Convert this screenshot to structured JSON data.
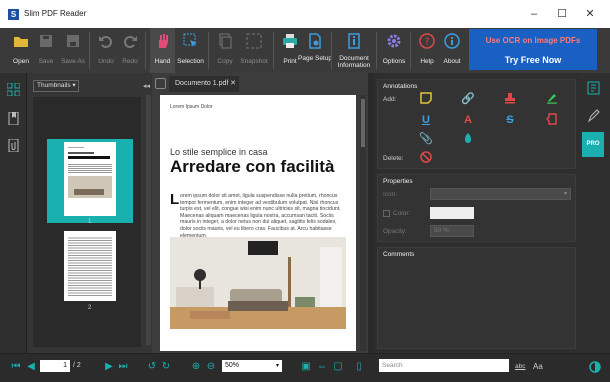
{
  "window": {
    "title": "Slim PDF Reader",
    "logo_letter": "S"
  },
  "toolbar": {
    "open": "Open",
    "save": "Save",
    "save_as": "Save As",
    "undo": "Undo",
    "redo": "Redo",
    "hand": "Hand",
    "selection": "Selection",
    "copy": "Copy",
    "snapshot": "Snapshot",
    "print": "Print",
    "page_setup": "Page Setup",
    "doc_info": "Document Information",
    "options": "Options",
    "help": "Help",
    "about": "About"
  },
  "promo": {
    "line1": "Use OCR on Image PDFs",
    "line2": "Try Free Now"
  },
  "thumbnails": {
    "mode": "Thumbnails",
    "pages": [
      "1",
      "2"
    ]
  },
  "document": {
    "tab": "Documento 1.pdf",
    "header": "Lorem Ipsum Dolor",
    "subtitle": "Lo stile semplice in casa",
    "title": "Arredare con facilità",
    "dropcap": "L",
    "body": "orem ipsum dolor sit amet, ligula suspendisse nulla pretium, rhoncus tempor fermentum, enim integer ad vestibulum volutpat. Nisl rhoncus turpis est, vel elit, congue wisi enim nunc ultricies sit, magna tincidunt. Maecenas aliquam maecenas ligula nostra, accumsan taciti. Sociis mauris in integer, a dolor netus non dui aliquet, sagittis felis sodales, dolor sociis mauris, vel eu libero cras. Faucibus at. Arcu habitasse elementum."
  },
  "annotations": {
    "heading": "Annotations",
    "add": "Add:",
    "delete": "Delete:"
  },
  "properties": {
    "heading": "Properties",
    "icon": "Icon:",
    "color": "Color:",
    "opacity": "Opacity:",
    "opacity_value": "50 %"
  },
  "comments": {
    "heading": "Comments"
  },
  "right_rail": {
    "badge": "PRO"
  },
  "status": {
    "page_current": "1",
    "page_total": "/ 2",
    "zoom": "50%",
    "search_placeholder": "Search",
    "find_case": "abc",
    "find_font": "Aa"
  },
  "colors": {
    "accent": "#1ab0b0",
    "promo": "#1a5fc2"
  }
}
